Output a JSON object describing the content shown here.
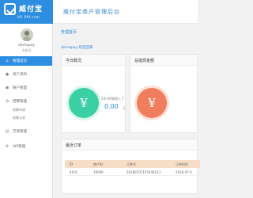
{
  "header": {
    "logo_text": "威付宝",
    "logo_sub": "VO PAY.com",
    "title": "威付宝商户管理后台"
  },
  "user": {
    "name": "demopay",
    "role": "主账号"
  },
  "sidebar": {
    "items": [
      {
        "label": "管理首页",
        "icon": "home-icon"
      },
      {
        "label": "商户资料",
        "icon": "user-icon"
      },
      {
        "label": "账户管理",
        "icon": "account-icon"
      },
      {
        "label": "结算管理",
        "icon": "settle-icon"
      },
      {
        "label": "交易管理",
        "icon": "trade-icon"
      },
      {
        "label": "API管理",
        "icon": "api-icon"
      }
    ],
    "sub_items": [
      "结算申请",
      "结算记录"
    ]
  },
  "main": {
    "breadcrumb": "管理首页",
    "welcome": "demopay,欢迎回来",
    "today_panel": {
      "title": "今日概况",
      "icon": "¥",
      "label": "24小时收款入了",
      "value": "0.00",
      "unit": "元"
    },
    "balance_panel": {
      "title": "总提现金额",
      "icon": "¥"
    },
    "orders_panel": {
      "title": "最近订单",
      "headers": [
        "ID",
        "商户ID",
        "订单号",
        "订单时间"
      ],
      "rows": [
        [
          "4101",
          "10009",
          "20180707155246213",
          "2018-07-0"
        ]
      ]
    }
  },
  "colors": {
    "accent": "#2d8de0",
    "green": "#3bcfa4",
    "orange": "#f07d5c",
    "table_header": "#f5ddc6"
  }
}
